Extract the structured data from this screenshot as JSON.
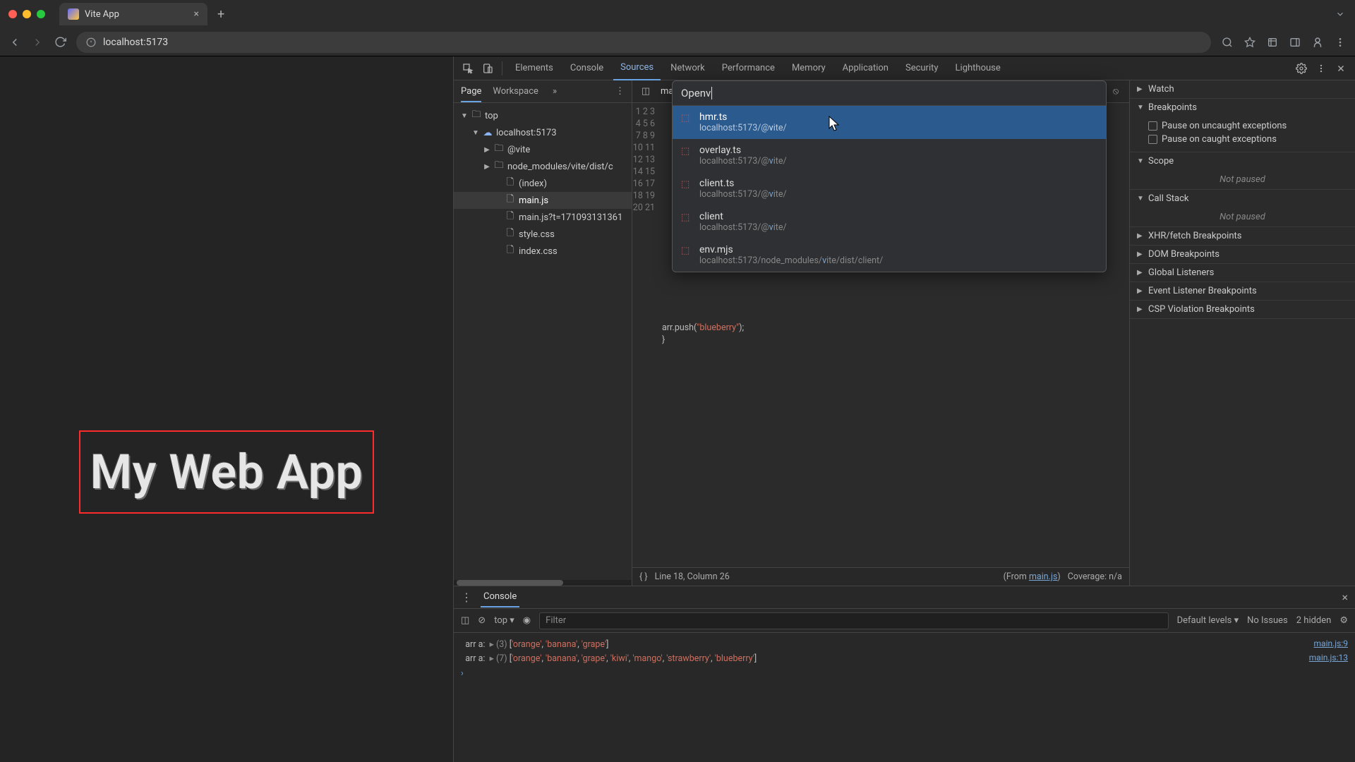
{
  "browser": {
    "tab_title": "Vite App",
    "url": "localhost:5173"
  },
  "page": {
    "heading": "My Web App"
  },
  "devtools": {
    "tabs": [
      "Elements",
      "Console",
      "Sources",
      "Network",
      "Performance",
      "Memory",
      "Application",
      "Security",
      "Lighthouse"
    ],
    "active_tab": "Sources",
    "nav": {
      "tabs": [
        "Page",
        "Workspace"
      ],
      "active": "Page",
      "tree": {
        "top": "top",
        "host": "localhost:5173",
        "folder": "@vite",
        "nm_path": "node_modules/vite/dist/c",
        "files": [
          "(index)",
          "main.js",
          "main.js?t=171093131361",
          "style.css",
          "index.css"
        ],
        "selected": "main.js"
      }
    },
    "editor": {
      "open_tab": "main",
      "line_count": 21,
      "code_line19_pre": "arr.push(",
      "code_line19_str": "\"blueberry\"",
      "code_line19_post": ");",
      "code_line20": "}",
      "status_pretty": "{ }",
      "status_pos": "Line 18, Column 26",
      "status_from_label": "(From ",
      "status_from_link": "main.js",
      "status_from_close": ")",
      "coverage": "Coverage: n/a"
    },
    "palette": {
      "label": "Open ",
      "query": "v",
      "items": [
        {
          "name": "hmr.ts",
          "path": "localhost:5173/@vite/",
          "selected": true
        },
        {
          "name": "overlay.ts",
          "path": "localhost:5173/@vite/",
          "selected": false
        },
        {
          "name": "client.ts",
          "path": "localhost:5173/@vite/",
          "selected": false
        },
        {
          "name": "client",
          "path": "localhost:5173/@vite/",
          "selected": false
        },
        {
          "name": "env.mjs",
          "path": "localhost:5173/node_modules/vite/dist/client/",
          "selected": false
        }
      ]
    },
    "debugger": {
      "sections": {
        "watch": "Watch",
        "breakpoints": "Breakpoints",
        "bp_uncaught": "Pause on uncaught exceptions",
        "bp_caught": "Pause on caught exceptions",
        "scope": "Scope",
        "callstack": "Call Stack",
        "xhr": "XHR/fetch Breakpoints",
        "dom": "DOM Breakpoints",
        "global": "Global Listeners",
        "event": "Event Listener Breakpoints",
        "csp": "CSP Violation Breakpoints",
        "not_paused": "Not paused"
      }
    }
  },
  "console": {
    "tab": "Console",
    "context": "top",
    "filter_placeholder": "Filter",
    "levels": "Default levels",
    "issues": "No Issues",
    "hidden": "2 hidden",
    "logs": [
      {
        "label": "arr a:",
        "count": 3,
        "items": [
          "'orange'",
          "'banana'",
          "'grape'"
        ],
        "src": "main.js:9"
      },
      {
        "label": "arr a:",
        "count": 7,
        "items": [
          "'orange'",
          "'banana'",
          "'grape'",
          "'kiwi'",
          "'mango'",
          "'strawberry'",
          "'blueberry'"
        ],
        "src": "main.js:13"
      }
    ]
  }
}
